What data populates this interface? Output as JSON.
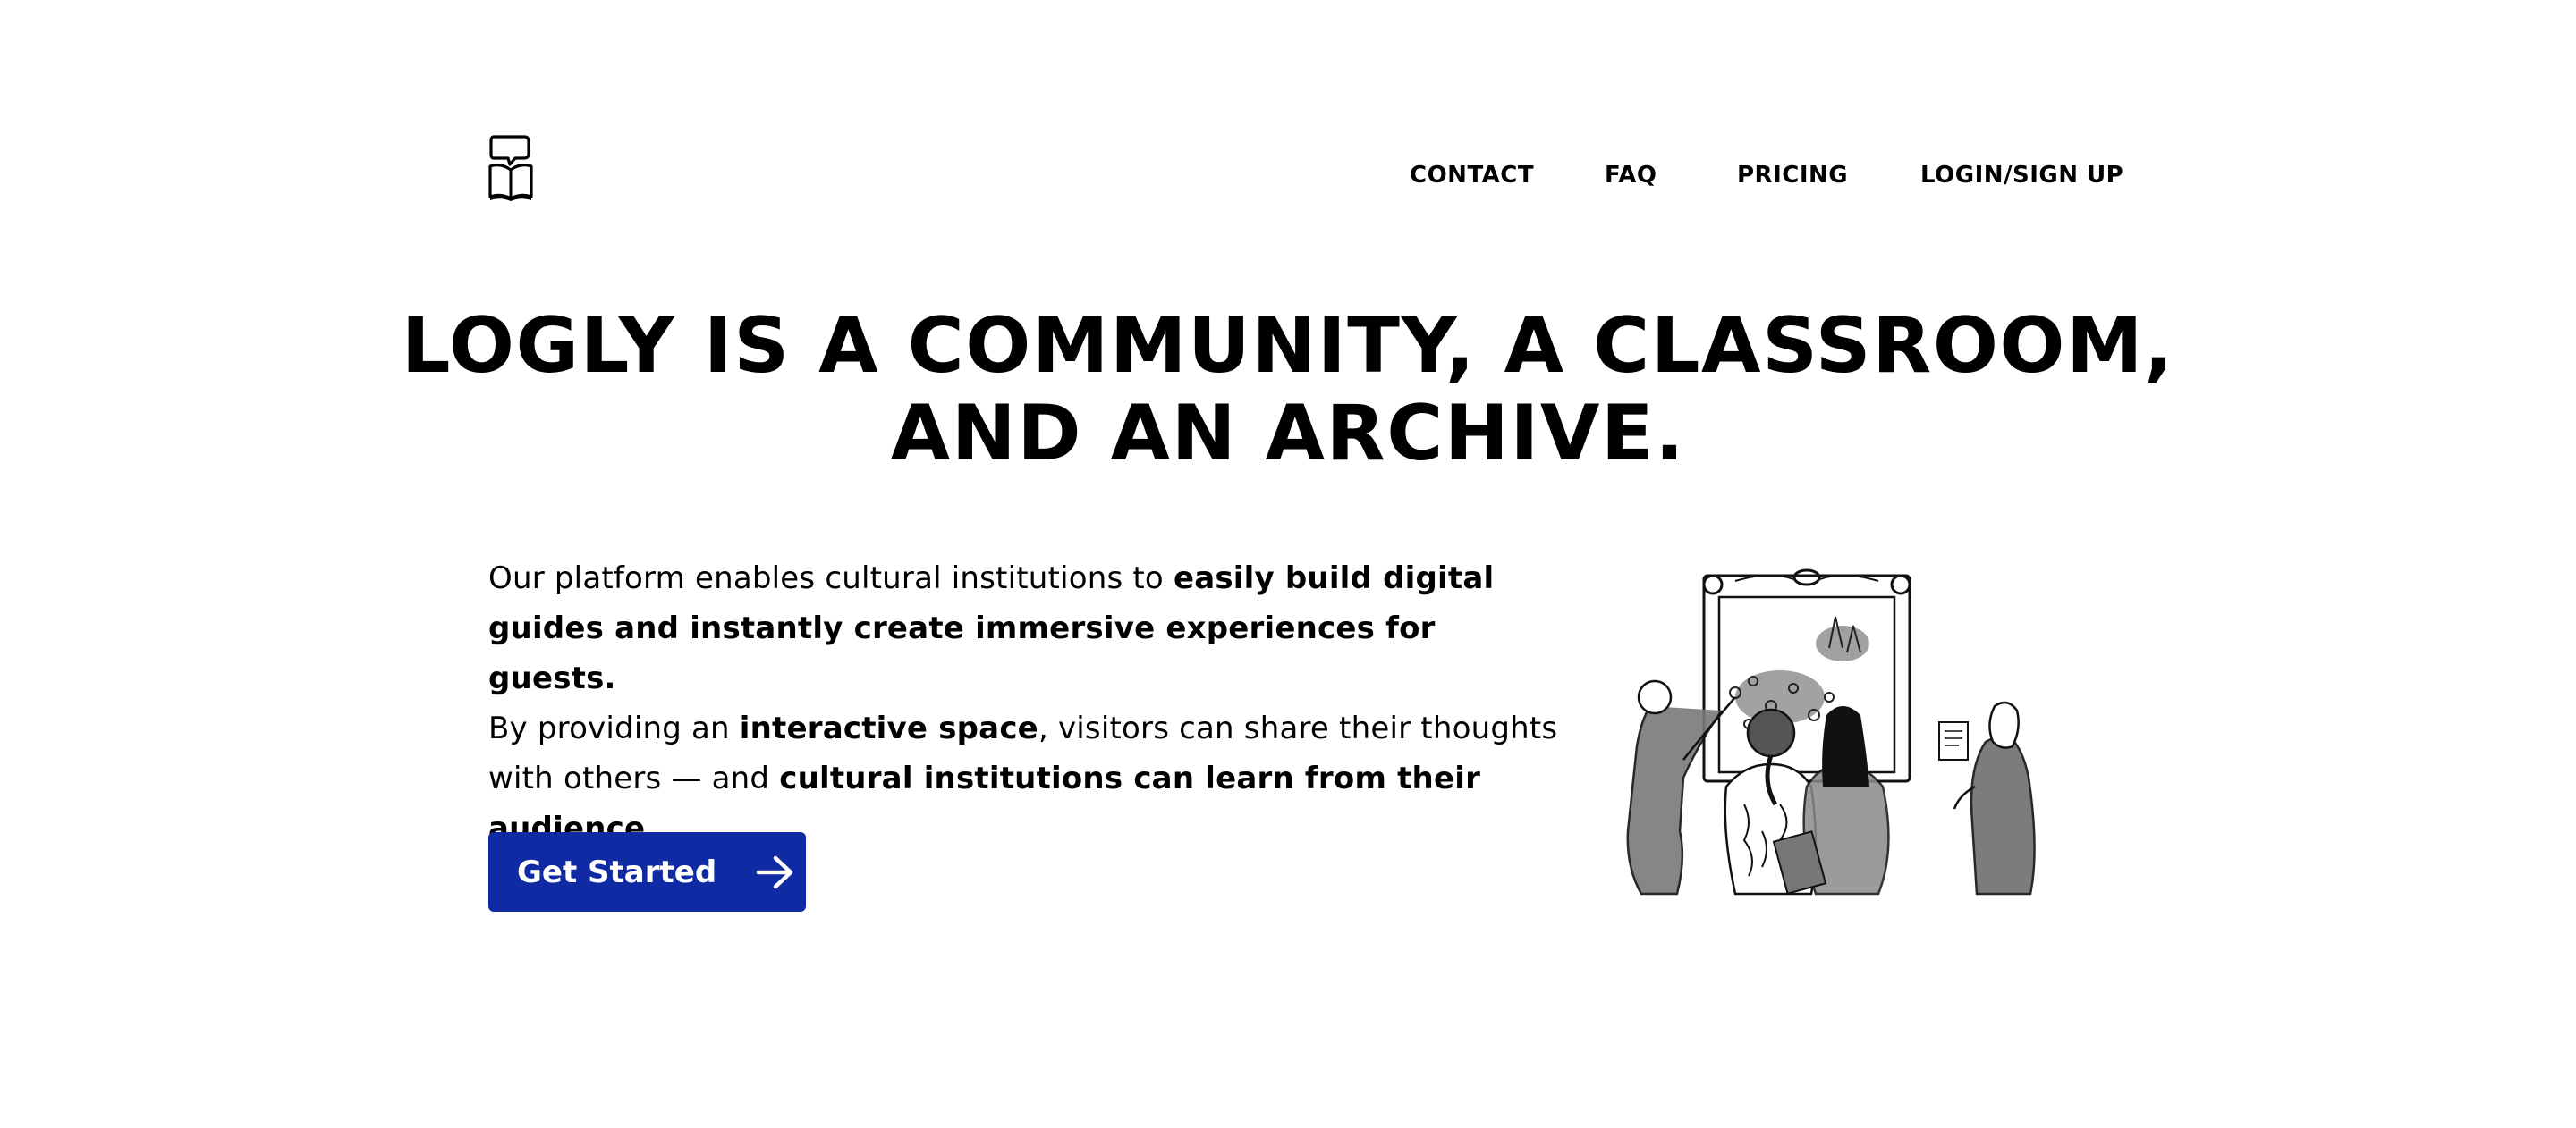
{
  "header": {
    "logo_icon": "book-with-speech-bubble-icon",
    "nav": [
      {
        "label": "CONTACT"
      },
      {
        "label": "FAQ"
      },
      {
        "label": "PRICING"
      },
      {
        "label": "LOGIN/SIGN UP"
      }
    ]
  },
  "hero": {
    "title_line1": "LOGLY IS A COMMUNITY, A CLASSROOM,",
    "title_line2": "AND AN ARCHIVE.",
    "paragraph1": {
      "plain1": "Our platform enables cultural institutions to ",
      "bold1": "easily build digital guides and instantly create immersive experiences for guests."
    },
    "paragraph2": {
      "plain1": "By providing an ",
      "bold1": "interactive space",
      "plain2": ", visitors can share their thoughts with others — and ",
      "bold2": "cultural institutions can learn from their audience."
    },
    "cta": {
      "label": "Get Started",
      "icon": "arrow-right-icon"
    },
    "illustration_icon": "museum-visitors-illustration"
  },
  "colors": {
    "cta_background": "#0f2aa3",
    "text": "#000000",
    "background": "#ffffff"
  }
}
